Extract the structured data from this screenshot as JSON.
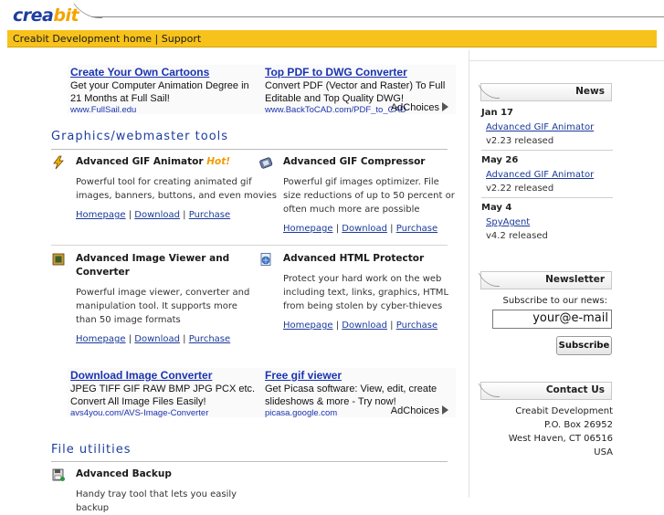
{
  "header": {
    "logo_main": "crea",
    "logo_accent": "bit",
    "nav_text": "Creabit Development home | Support"
  },
  "ads_top": {
    "left": {
      "title": "Create Your Own Cartoons",
      "desc": "Get your Computer Animation Degree in 21 Months at Full Sail!",
      "url": "www.FullSail.edu"
    },
    "right": {
      "title": "Top PDF to DWG Converter",
      "desc": "Convert PDF (Vector and Raster) To Full Editable and Top Quality DWG!",
      "url": "www.BackToCAD.com/PDF_to_CAD"
    },
    "adchoices": "AdChoices"
  },
  "ads_mid": {
    "left": {
      "title": "Download Image Converter",
      "desc": "JPEG TIFF GIF RAW BMP JPG PCX etc. Convert All Image Files Easily!",
      "url": "avs4you.com/AVS-Image-Converter"
    },
    "right": {
      "title": "Free gif viewer",
      "desc": "Get Picasa software: View, edit, create slideshows & more - Try now!",
      "url": "picasa.google.com"
    },
    "adchoices": "AdChoices"
  },
  "sections": {
    "graphics": {
      "title": "Graphics/webmaster tools",
      "items": [
        {
          "name": "Advanced GIF Animator",
          "hot": "Hot!",
          "desc": "Powerful tool for creating animated gif images, banners, buttons, and even movies",
          "link_home": "Homepage",
          "link_download": "Download",
          "link_purchase": "Purchase"
        },
        {
          "name": "Advanced GIF Compressor",
          "desc": "Powerful gif images optimizer. File size reductions of up to 50 percent or often much more are possible",
          "link_home": "Homepage",
          "link_download": "Download",
          "link_purchase": "Purchase"
        },
        {
          "name": "Advanced Image Viewer and Converter",
          "desc": "Powerful image viewer, converter and manipulation tool. It supports more than 50 image formats",
          "link_home": "Homepage",
          "link_download": "Download",
          "link_purchase": "Purchase"
        },
        {
          "name": "Advanced HTML Protector",
          "desc": "Protect your hard work on the web including text, links, graphics, HTML from being stolen by cyber-thieves",
          "link_home": "Homepage",
          "link_download": "Download",
          "link_purchase": "Purchase"
        }
      ]
    },
    "file": {
      "title": "File utilities",
      "items": [
        {
          "name": "Advanced Backup",
          "desc": "Handy tray tool that lets you easily backup"
        }
      ]
    }
  },
  "separator": "|",
  "news": {
    "title": "News",
    "entries": [
      {
        "date": "Jan 17",
        "link": "Advanced GIF Animator",
        "text": "v2.23 released"
      },
      {
        "date": "May 26",
        "link": "Advanced GIF Animator",
        "text": "v2.22 released"
      },
      {
        "date": "May 4",
        "link": "SpyAgent",
        "text": "v4.2 released"
      }
    ]
  },
  "newsletter": {
    "title": "Newsletter",
    "label": "Subscribe to our news:",
    "email_value": "your@e-mail",
    "button": "Subscribe"
  },
  "contact": {
    "title": "Contact Us",
    "lines": [
      "Creabit Development",
      "P.O. Box 26952",
      "West Haven, CT 06516",
      "USA"
    ]
  },
  "colors": {
    "nav_bg": "#f7c21b",
    "brand_blue": "#1d3e9e",
    "hot_orange": "#f39a00",
    "link_blue": "#1a3a9a"
  }
}
